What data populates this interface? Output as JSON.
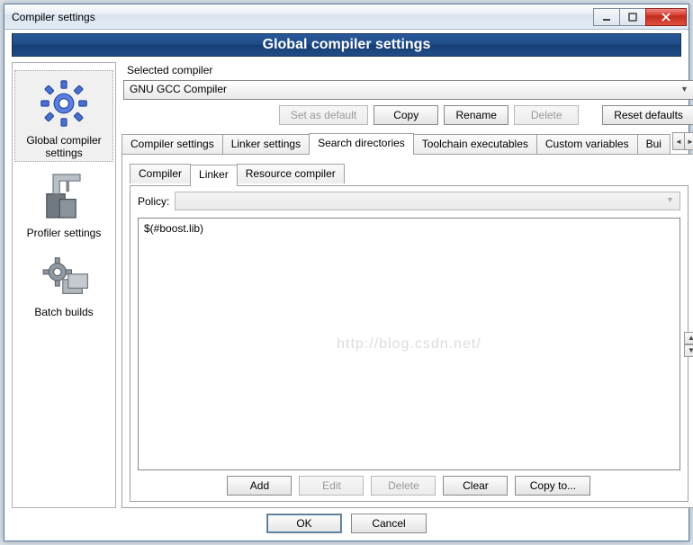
{
  "window": {
    "title": "Compiler settings"
  },
  "heading": "Global compiler settings",
  "sidebar": {
    "items": [
      {
        "label": "Global compiler settings"
      },
      {
        "label": "Profiler settings"
      },
      {
        "label": "Batch builds"
      }
    ]
  },
  "compiler": {
    "group_label": "Selected compiler",
    "value": "GNU GCC Compiler",
    "buttons": {
      "set_default": "Set as default",
      "copy": "Copy",
      "rename": "Rename",
      "delete": "Delete",
      "reset": "Reset defaults"
    }
  },
  "main_tabs": {
    "items": [
      "Compiler settings",
      "Linker settings",
      "Search directories",
      "Toolchain executables",
      "Custom variables",
      "Bui"
    ],
    "active": 2
  },
  "sub_tabs": {
    "items": [
      "Compiler",
      "Linker",
      "Resource compiler"
    ],
    "active": 1
  },
  "policy": {
    "label": "Policy:"
  },
  "directories": {
    "items": [
      "$(#boost.lib)"
    ]
  },
  "list_buttons": {
    "add": "Add",
    "edit": "Edit",
    "delete": "Delete",
    "clear": "Clear",
    "copy_to": "Copy to..."
  },
  "dialog_buttons": {
    "ok": "OK",
    "cancel": "Cancel"
  },
  "watermark": "http://blog.csdn.net/"
}
